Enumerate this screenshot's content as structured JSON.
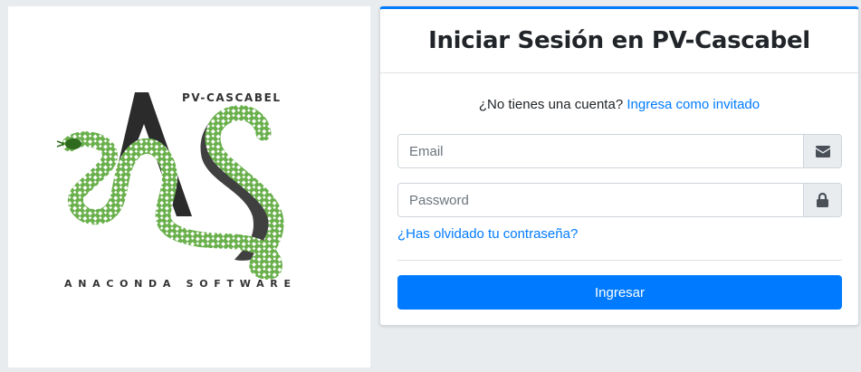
{
  "logo": {
    "top_text": "PV-CASCABEL",
    "bottom_text": "ANACONDA SOFTWARE",
    "snake_color": "#6ab04c",
    "letters_color": "#2b2b2b"
  },
  "login": {
    "title": "Iniciar Sesión en PV-Cascabel",
    "no_account_text": "¿No tienes una cuenta?",
    "guest_link": "Ingresa como invitado",
    "email_placeholder": "Email",
    "email_icon": "envelope-icon",
    "password_placeholder": "Password",
    "password_icon": "lock-icon",
    "forgot_link": "¿Has olvidado tu contraseña?",
    "submit_label": "Ingresar"
  },
  "colors": {
    "accent": "#007bff",
    "page_bg": "#e9ecef"
  }
}
